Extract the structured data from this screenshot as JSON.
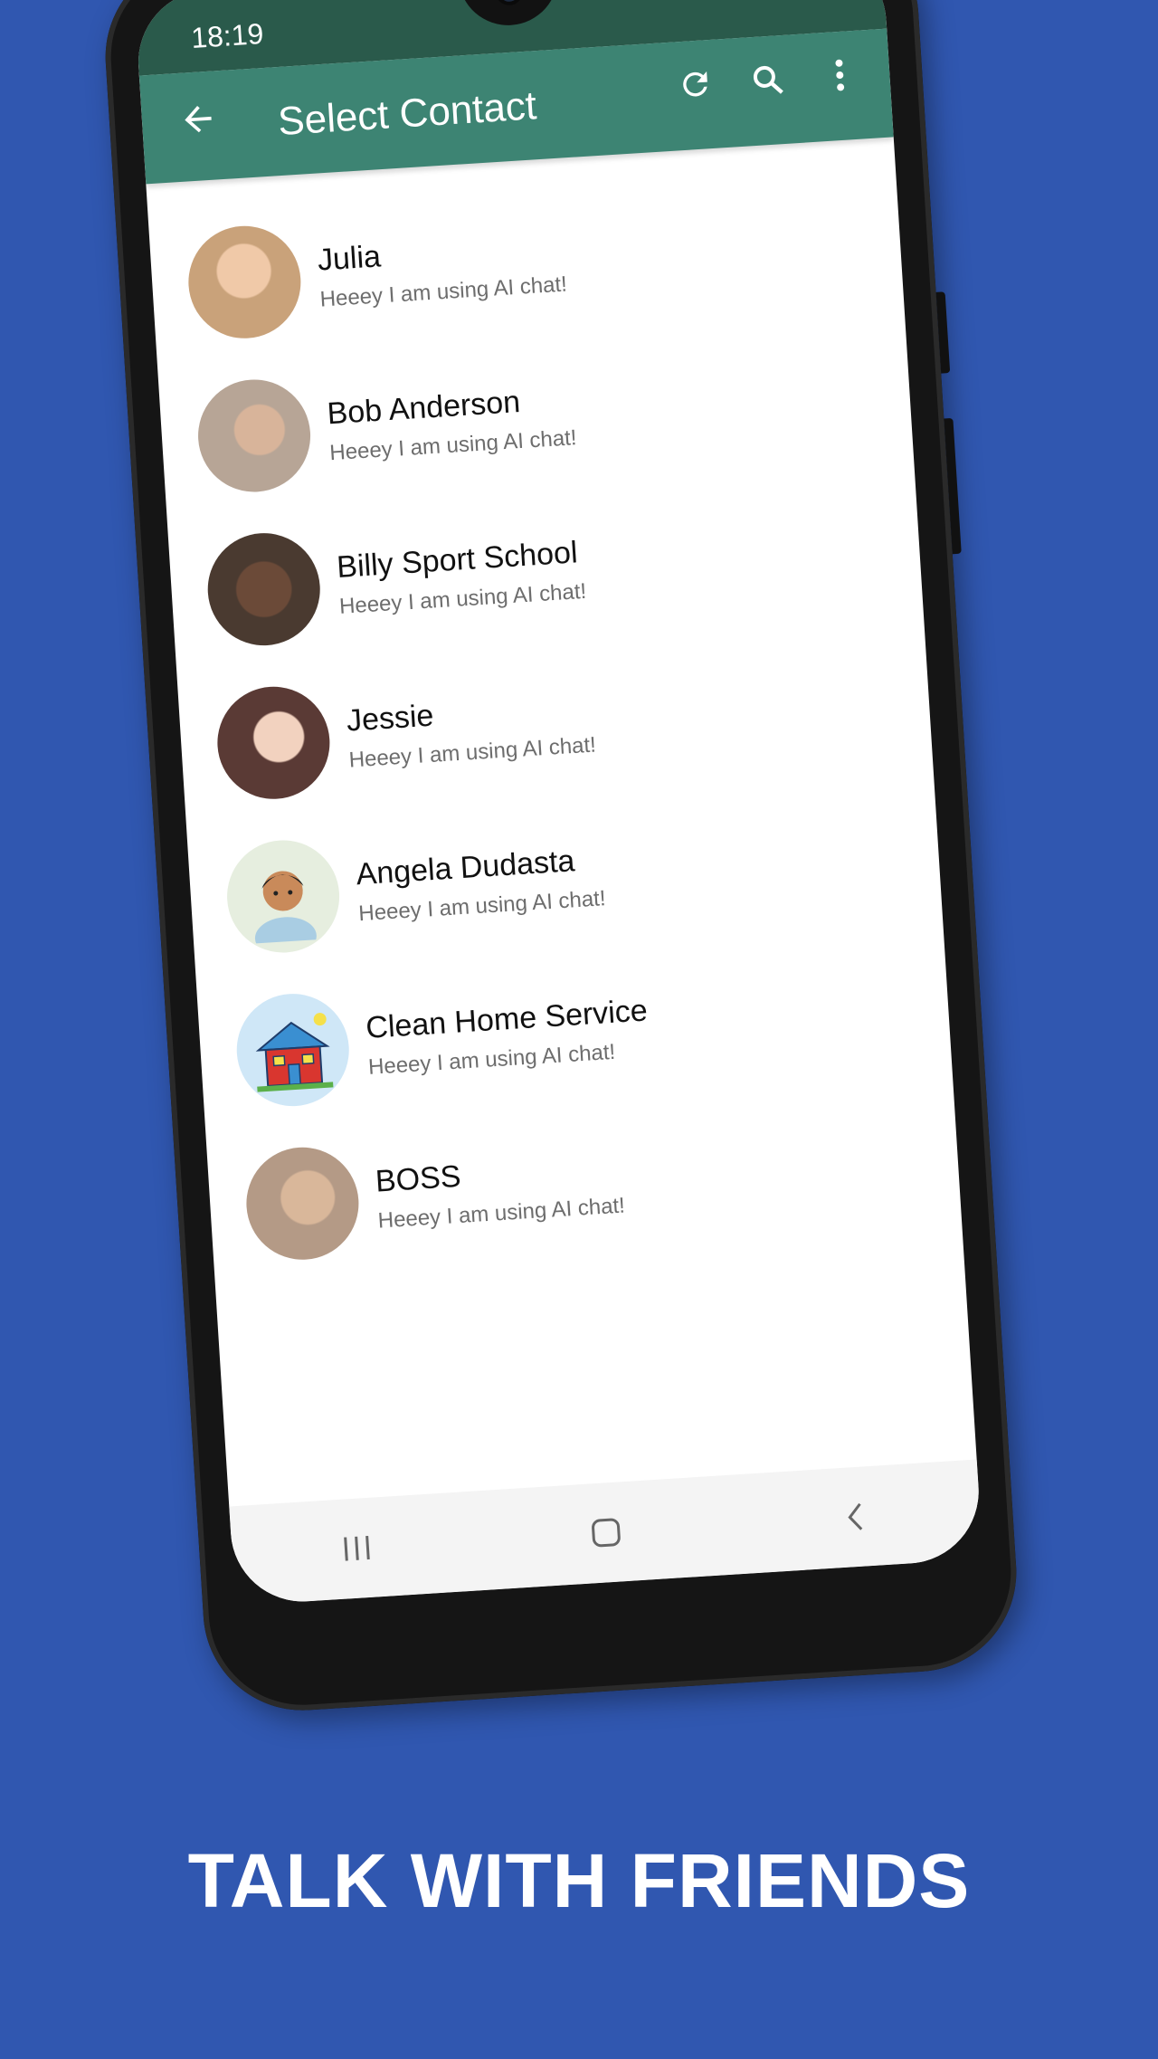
{
  "status_bar": {
    "time": "18:19",
    "icons": "wifi-icon signal-icon"
  },
  "app_bar": {
    "title": "Select Contact",
    "back_icon": "arrow-left-icon",
    "refresh_icon": "refresh-icon",
    "search_icon": "search-icon",
    "more_icon": "more-vert-icon"
  },
  "contacts": [
    {
      "name": "Julia",
      "status": "Heeey I am using AI chat!",
      "avatar_color": "#c9a27a"
    },
    {
      "name": "Bob Anderson",
      "status": "Heeey I am using AI chat!",
      "avatar_color": "#b7a596"
    },
    {
      "name": "Billy Sport School",
      "status": "Heeey I am using AI chat!",
      "avatar_color": "#4a3a30"
    },
    {
      "name": "Jessie",
      "status": "Heeey I am using AI chat!",
      "avatar_color": "#5a3a35"
    },
    {
      "name": "Angela Dudasta",
      "status": "Heeey I am using AI chat!",
      "avatar_color": "#e6eedf"
    },
    {
      "name": "Clean Home Service",
      "status": "Heeey I am using AI chat!",
      "avatar_color": "#cfe7f7"
    },
    {
      "name": "BOSS",
      "status": "Heeey I am using AI chat!",
      "avatar_color": "#b49a86"
    }
  ],
  "nav_bar": {
    "recents_icon": "recents-icon",
    "home_icon": "home-icon",
    "back_icon": "back-chevron-icon"
  },
  "colors": {
    "background": "#3057b0",
    "app_bar": "#3d8473",
    "status_bar": "#2a5a4b"
  },
  "caption": "TALK WITH FRIENDS"
}
